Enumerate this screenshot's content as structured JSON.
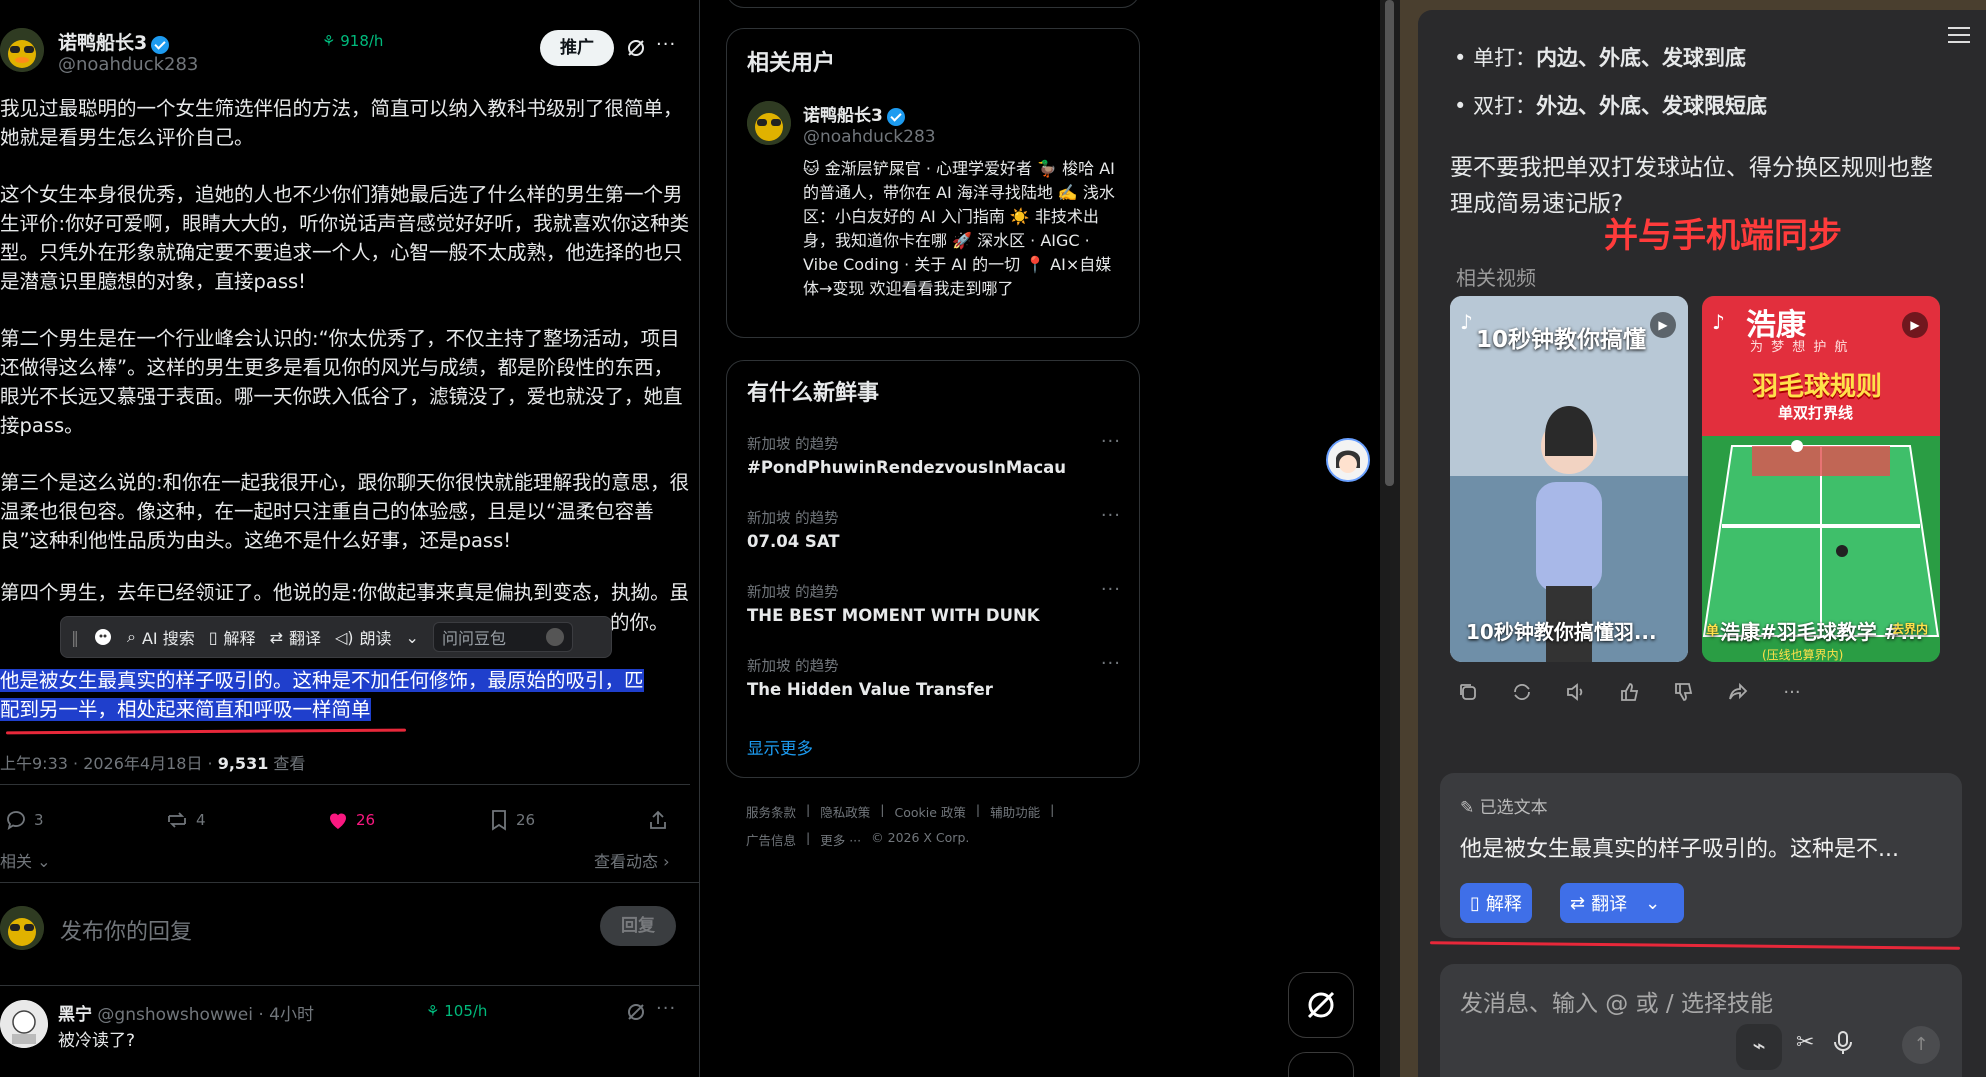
{
  "post": {
    "author_name": "诺鸭船长3",
    "author_handle": "@noahduck283",
    "rate": "918/h",
    "promote_label": "推广",
    "paragraphs": [
      "我见过最聪明的一个女生筛选伴侣的方法，简直可以纳入教科书级别了很简单，她就是看男生怎么评价自己。",
      "这个女生本身很优秀，追她的人也不少你们猜她最后选了什么样的男生第一个男生评价:你好可爱啊，眼睛大大的，听你说话声音感觉好好听，我就喜欢你这种类型。只凭外在形象就确定要不要追求一个人，心智一般不太成熟，他选择的也只是潜意识里臆想的对象，直接pass!",
      "第二个男生是在一个行业峰会认识的:“你太优秀了，不仅主持了整场活动，项目还做得这么棒”。这样的男生更多是看见你的风光与成绩，都是阶段性的东西，眼光不长远又慕强于表面。哪一天你跌入低谷了，滤镜没了，爱也就没了，她直接pass。",
      "第三个是这么说的:和你在一起我很开心，跟你聊天你很快就能理解我的意思，很温柔也很包容。像这种，在一起时只注重自己的体验感，且是以“温柔包容善良”这种利他性品质为由头。这绝不是什么好事，还是pass!"
    ],
    "para5_start": "第四个男生，去年已经领证了。他说的是:你做起事来真是偏执到变态，执拗。虽",
    "para5_end": "的你。",
    "selected_text_line1": "他是被女生最真实的样子吸引的。这种是不加任何修饰，最原始的吸引，匹",
    "selected_text_line2": "配到另一半，相处起来简直和呼吸一样简单",
    "time": "上午9:33 · 2026年4月18日 · ",
    "views_count": "9,531",
    "views_label": " 查看",
    "replies": "3",
    "reposts": "4",
    "likes": "26",
    "bookmarks": "26",
    "related_label": "相关",
    "view_activity": "查看动态",
    "reply_placeholder": "发布你的回复",
    "reply_button": "回复"
  },
  "toolbar": {
    "ai_search": "AI 搜索",
    "explain": "解释",
    "translate": "翻译",
    "read_aloud": "朗读",
    "ask_placeholder": "问问豆包"
  },
  "reply_item": {
    "name": "黑宁",
    "handle": "@gnshowshowwei · 4小时",
    "rate": "105/h",
    "text": "被冷读了?"
  },
  "related_users": {
    "title": "相关用户",
    "name": "诺鸭船长3",
    "handle": "@noahduck283",
    "bio": "🐱 金渐层铲屎官 · 心理学爱好者 🦆 梭哈 AI 的普通人，带你在 AI 海洋寻找陆地 ✍️ 浅水区：小白友好的 AI 入门指南 ☀️ 非技术出身，我知道你卡在哪 🚀 深水区 · AIGC · Vibe Coding · 关于 AI 的一切 📍 AI×自媒体→变现 欢迎看看我走到哪了"
  },
  "trends": {
    "title": "有什么新鲜事",
    "items": [
      {
        "sub": "新加坡 的趋势",
        "title": "#PondPhuwinRendezvousInMacau"
      },
      {
        "sub": "新加坡 的趋势",
        "title": "07.04 SAT"
      },
      {
        "sub": "新加坡 的趋势",
        "title": "THE BEST MOMENT WITH DUNK"
      },
      {
        "sub": "新加坡 的趋势",
        "title": "The Hidden Value Transfer"
      }
    ],
    "show_more": "显示更多"
  },
  "footer": {
    "links1": [
      "服务条款",
      "隐私政策",
      "Cookie 政策",
      "辅助功能"
    ],
    "links2": [
      "广告信息",
      "更多 ···",
      "© 2026 X Corp."
    ]
  },
  "assistant": {
    "bullet1_label": "单打：",
    "bullet1_value": "内边、外底、发球到底",
    "bullet2_label": "双打：",
    "bullet2_value": "外边、外底、发球限短底",
    "question": "要不要我把单双打发球站位、得分换区规则也整理成简易速记版?",
    "overlay_note": "并与手机端同步",
    "related_videos_label": "相关视频",
    "videos": [
      {
        "overlay": "10秒钟教你搞懂",
        "caption": "10秒钟教你搞懂羽..."
      },
      {
        "overlay": "浩康",
        "subtitle": "为 梦 想 护 航",
        "banner": "羽毛球规则",
        "sub_banner": "单双打界线",
        "caption": "浩康#羽毛球教学 #...",
        "small_left": "单",
        "small_right": "去界内",
        "bottom": "(压线也算界内)"
      }
    ],
    "selected_label": "已选文本",
    "selected_preview": "他是被女生最真实的样子吸引的。这种是不...",
    "explain_btn": "解释",
    "translate_btn": "翻译",
    "composer_placeholder": "发消息、输入 @ 或 / 选择技能"
  },
  "colors": {
    "accent_blue": "#1d9bf0",
    "like_pink": "#f91880",
    "selection": "#1f3fcc",
    "annotation_red": "#e8283a",
    "assistant_button": "#3f6fe8"
  }
}
